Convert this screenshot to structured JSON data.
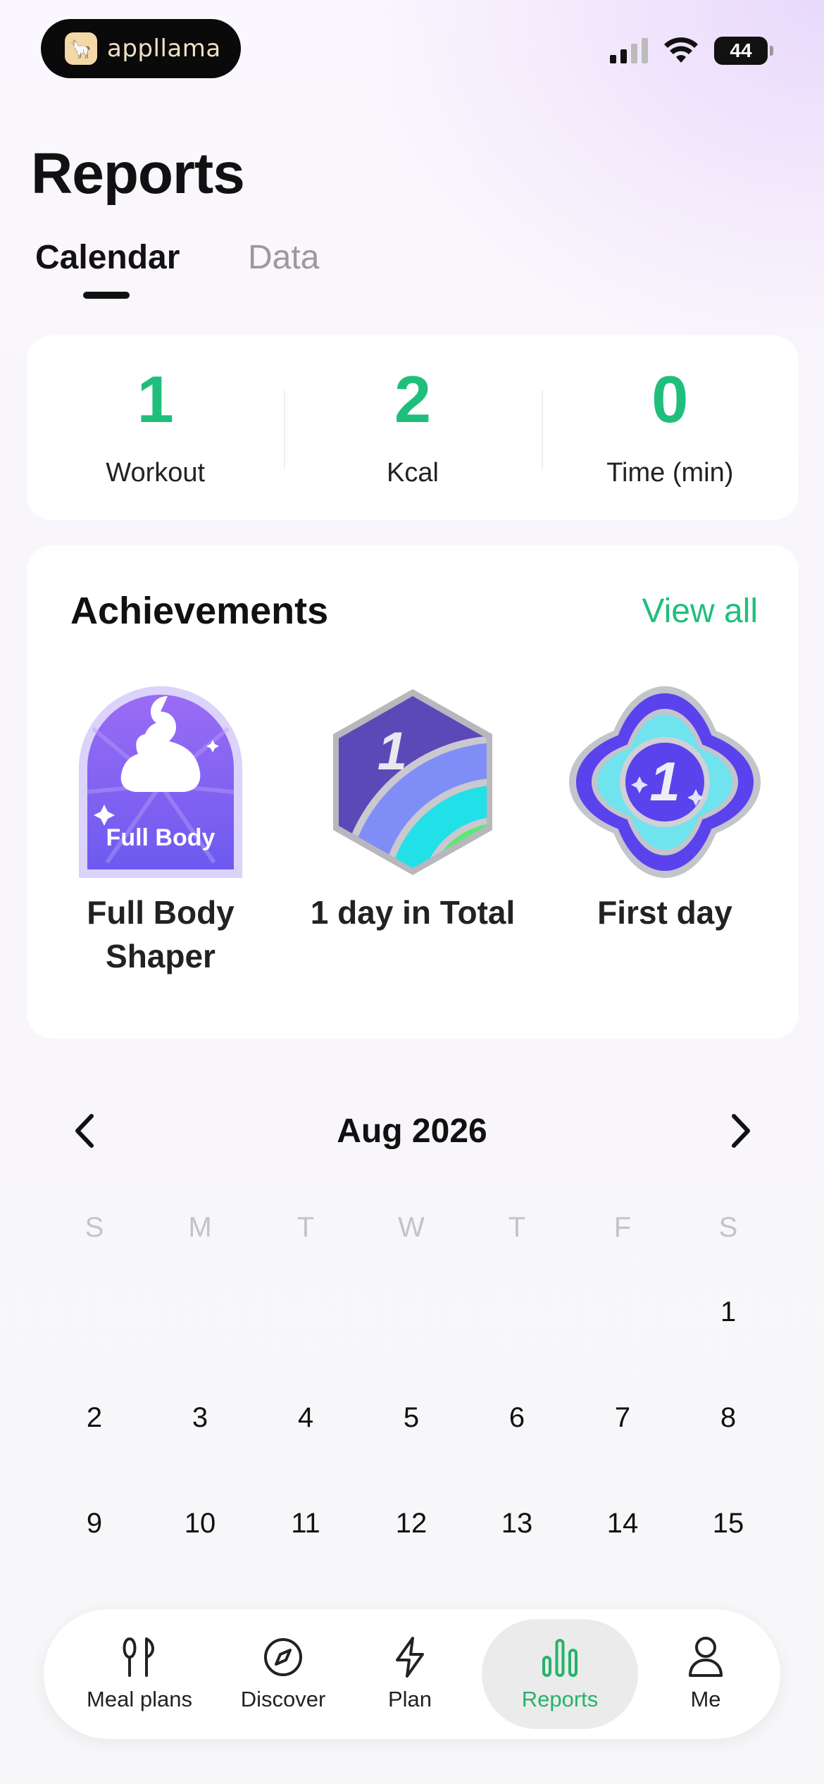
{
  "status_bar": {
    "brand": "appllama",
    "battery": "44"
  },
  "header": {
    "title": "Reports",
    "tabs": [
      {
        "label": "Calendar",
        "active": true
      },
      {
        "label": "Data",
        "active": false
      }
    ]
  },
  "summary": {
    "stats": [
      {
        "value": "1",
        "label": "Workout"
      },
      {
        "value": "2",
        "label": "Kcal"
      },
      {
        "value": "0",
        "label": "Time (min)"
      }
    ]
  },
  "achievements": {
    "title": "Achievements",
    "view_all": "View all",
    "badges": [
      {
        "label": "Full Body Shaper",
        "art_text": "Full Body",
        "icon": "full-body-badge-icon"
      },
      {
        "label": "1 day in Total",
        "art_text": "1",
        "icon": "one-day-total-badge-icon"
      },
      {
        "label": "First day",
        "art_text": "1",
        "icon": "first-day-badge-icon"
      }
    ]
  },
  "calendar": {
    "month": "Aug 2026",
    "weekdays": [
      "S",
      "M",
      "T",
      "W",
      "T",
      "F",
      "S"
    ],
    "weeks": [
      [
        "",
        "",
        "",
        "",
        "",
        "",
        "1"
      ],
      [
        "2",
        "3",
        "4",
        "5",
        "6",
        "7",
        "8"
      ],
      [
        "9",
        "10",
        "11",
        "12",
        "13",
        "14",
        "15"
      ]
    ]
  },
  "bottom_nav": {
    "items": [
      {
        "label": "Meal plans",
        "icon": "utensils-icon",
        "active": false
      },
      {
        "label": "Discover",
        "icon": "compass-icon",
        "active": false
      },
      {
        "label": "Plan",
        "icon": "lightning-icon",
        "active": false
      },
      {
        "label": "Reports",
        "icon": "bar-chart-icon",
        "active": true
      },
      {
        "label": "Me",
        "icon": "person-icon",
        "active": false
      }
    ]
  },
  "colors": {
    "accent_green": "#1fbf7b",
    "nav_active_green": "#24b36a",
    "badge_purple": "#6a4ef0"
  }
}
